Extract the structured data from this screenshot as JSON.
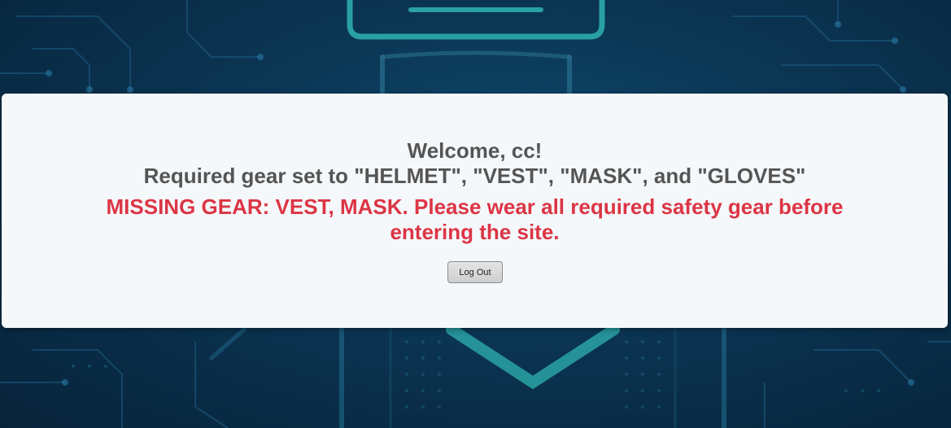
{
  "welcome": {
    "greeting": "Welcome, cc!",
    "required_gear": "Required gear set to \"HELMET\", \"VEST\", \"MASK\", and \"GLOVES\"",
    "missing_gear": "MISSING GEAR: VEST, MASK. Please wear all required safety gear before entering the site."
  },
  "actions": {
    "logout_label": "Log Out"
  },
  "colors": {
    "background": "#0b3553",
    "card": "#f5f8fa",
    "text": "#555555",
    "warning": "#dc3545",
    "glow": "#2fb3b0"
  }
}
